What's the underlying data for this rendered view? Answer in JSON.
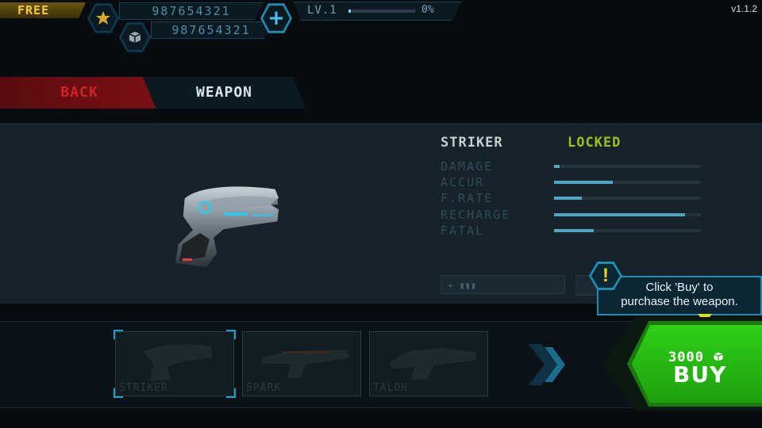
{
  "version": "v1.1.2",
  "top_bar": {
    "free_label": "FREE",
    "gold_amount": "987654321",
    "crystal_amount": "987654321",
    "add_label": "+",
    "level_label": "LV.1",
    "level_progress": 0.03,
    "level_percent": "0%"
  },
  "nav": {
    "back_label": "BACK",
    "title": "WEAPON"
  },
  "weapon": {
    "name": "STRIKER",
    "status": "LOCKED",
    "stats": [
      {
        "label": "DAMAGE",
        "value": 0.04
      },
      {
        "label": "ACCUR",
        "value": 0.4
      },
      {
        "label": "F.RATE",
        "value": 0.19
      },
      {
        "label": "RECHARGE",
        "value": 0.89
      },
      {
        "label": "FATAL",
        "value": 0.27
      }
    ],
    "ammo_label": "+ ▮▮▮"
  },
  "tooltip": {
    "icon": "!",
    "line1": "Click 'Buy' to",
    "line2": "purchase the weapon."
  },
  "weapon_slots": [
    {
      "label": "STRIKER",
      "selected": true
    },
    {
      "label": "SPARK",
      "selected": false
    },
    {
      "label": "TALON",
      "selected": false
    }
  ],
  "buy": {
    "price": "3000",
    "label": "BUY"
  },
  "colors": {
    "accent": "#1fa0cf",
    "locked": "#9cbf1e",
    "buy": "#2fcf18",
    "back": "#d02228",
    "gold": "#f2c93a"
  }
}
